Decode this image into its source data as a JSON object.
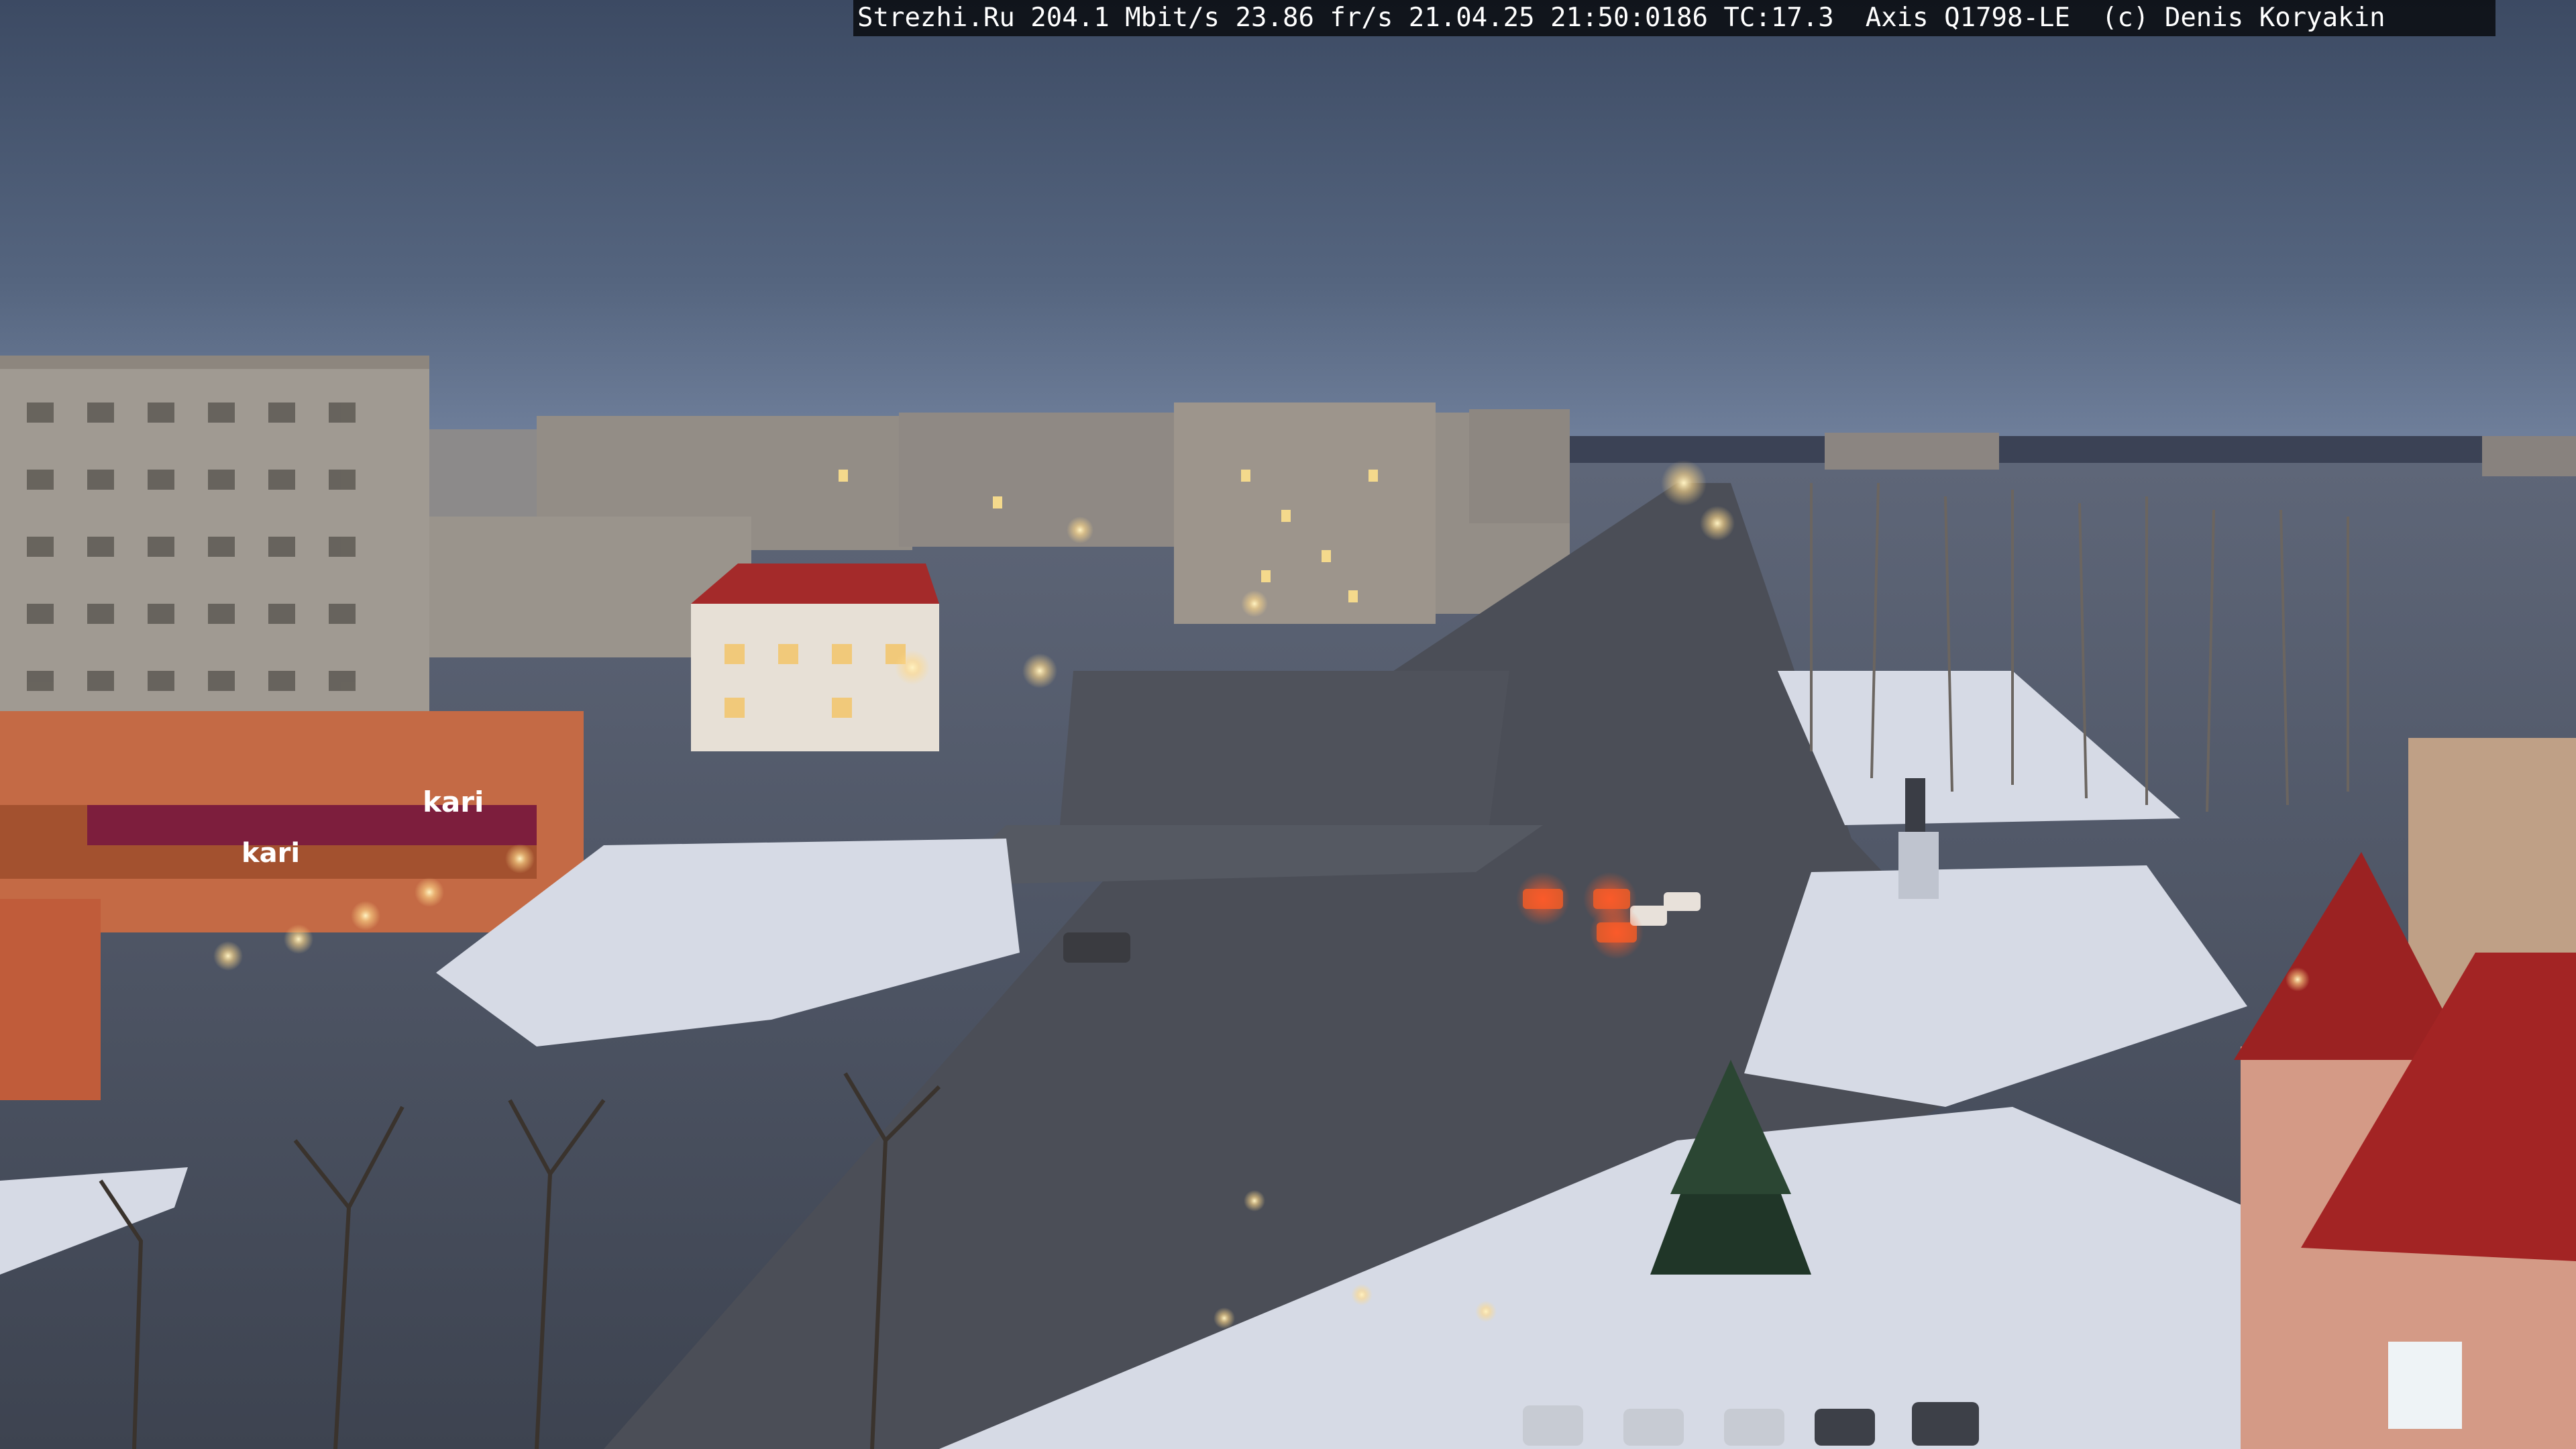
{
  "camera_overlay": {
    "text": "Strezhi.Ru 204.1 Mbit/s 23.86 fr/s 21.04.25 21:50:0186 TC:17.3  Axis Q1798-LE  (c) Denis Koryakin"
  },
  "scene_signage": {
    "store_logo": "kari",
    "store_logo_2": "kari"
  },
  "colors": {
    "sky_top": "#3f4d66",
    "sky_horizon": "#6f7f99",
    "road": "#4a4d55",
    "snow": "#d9dde7",
    "roof_red": "#a42a2a",
    "lamp": "#ffe7a8"
  }
}
